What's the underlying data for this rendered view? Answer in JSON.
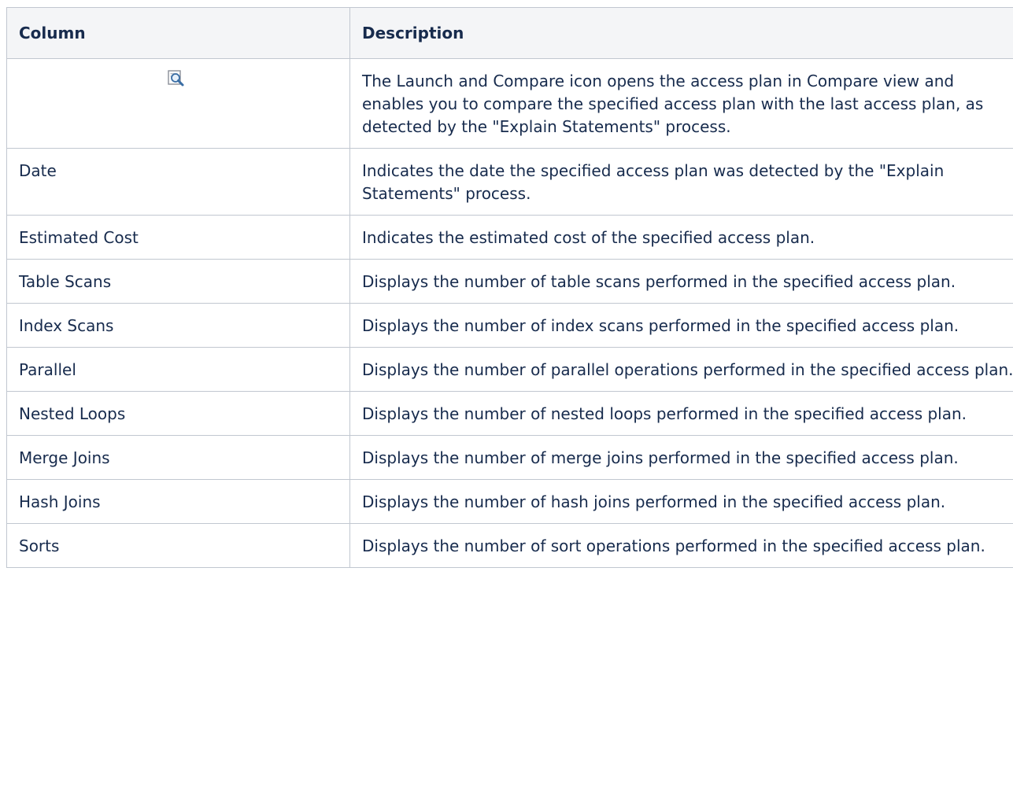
{
  "table": {
    "headers": {
      "column": "Column",
      "description": "Description"
    },
    "icon_row": {
      "icon": "launch-and-compare-icon",
      "description": "The Launch and Compare icon opens the access plan in Compare view and enables you to compare the specified access plan with the last access plan, as detected by the \"Explain Statements\" process."
    },
    "rows": [
      {
        "column": "Date",
        "description": "Indicates the date the specified access plan was detected by the \"Explain Statements\" process."
      },
      {
        "column": "Estimated Cost",
        "description": "Indicates the estimated cost of the specified access plan."
      },
      {
        "column": "Table Scans",
        "description": "Displays the number of table scans performed in the specified access plan."
      },
      {
        "column": "Index Scans",
        "description": "Displays the number of index scans performed in the specified access plan."
      },
      {
        "column": "Parallel",
        "description": "Displays the number of parallel operations performed in the specified access plan."
      },
      {
        "column": "Nested Loops",
        "description": "Displays the number of nested loops performed in the specified access plan."
      },
      {
        "column": "Merge Joins",
        "description": "Displays the number of merge joins performed in the specified access plan."
      },
      {
        "column": "Hash Joins",
        "description": "Displays the number of hash joins performed in the specified access plan."
      },
      {
        "column": "Sorts",
        "description": "Displays the number of sort operations performed in the specified access plan."
      }
    ]
  }
}
